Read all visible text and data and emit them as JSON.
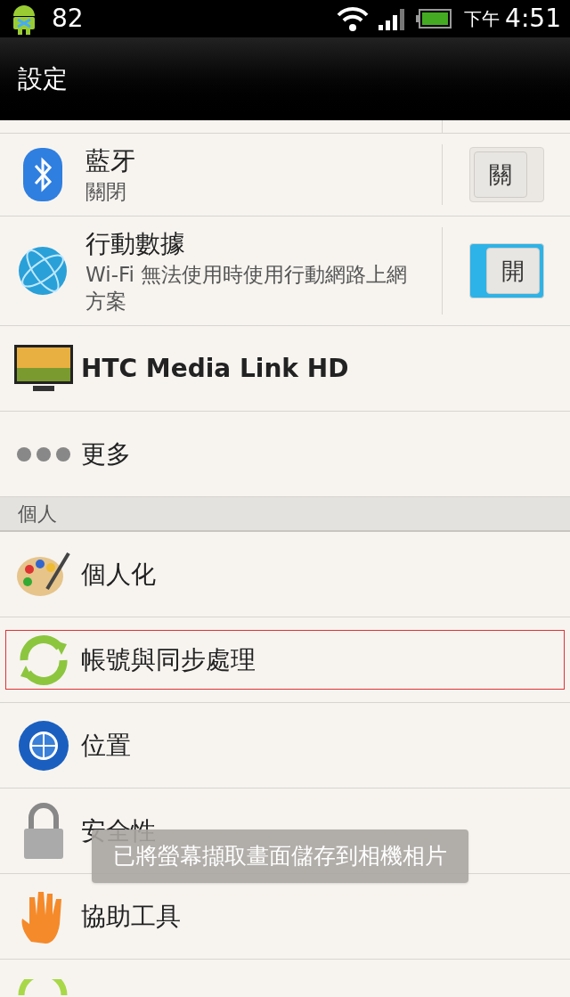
{
  "status_bar": {
    "notification_count": "82",
    "period": "下午",
    "time": "4:51"
  },
  "title": "設定",
  "items": [
    {
      "kind": "toggle",
      "title": "藍牙",
      "subtitle": "關閉",
      "toggle": {
        "label": "關",
        "on": false
      }
    },
    {
      "kind": "toggle",
      "title": "行動數據",
      "subtitle": "Wi-Fi 無法使用時使用行動網路上網方案",
      "toggle": {
        "label": "開",
        "on": true
      }
    },
    {
      "kind": "plain",
      "title": "HTC Media Link HD",
      "bold": true,
      "highlighted": false
    },
    {
      "kind": "plain",
      "title": "更多",
      "bold": false,
      "highlighted": false
    },
    {
      "kind": "header",
      "title": "個人"
    },
    {
      "kind": "plain",
      "title": "個人化",
      "bold": false,
      "highlighted": false
    },
    {
      "kind": "plain",
      "title": "帳號與同步處理",
      "bold": false,
      "highlighted": true
    },
    {
      "kind": "plain",
      "title": "位置",
      "bold": false,
      "highlighted": false
    },
    {
      "kind": "plain",
      "title": "安全性",
      "bold": false,
      "highlighted": false
    },
    {
      "kind": "plain",
      "title": "協助工具",
      "bold": false,
      "highlighted": false
    }
  ],
  "toast": "已將螢幕擷取畫面儲存到相機相片"
}
